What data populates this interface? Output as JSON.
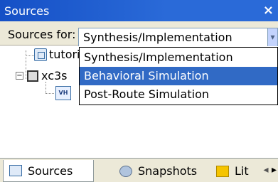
{
  "panel": {
    "title": "Sources"
  },
  "filter": {
    "label": "Sources for:",
    "selected": "Synthesis/Implementation",
    "options": [
      "Synthesis/Implementation",
      "Behavioral Simulation",
      "Post-Route Simulation"
    ],
    "highlighted_index": 1
  },
  "tree": {
    "items": [
      {
        "label": "tutori",
        "icon": "project-doc-icon"
      },
      {
        "label": "xc3s",
        "icon": "chip-icon",
        "expander": "−"
      },
      {
        "label": "",
        "icon": "vhdl-file-icon"
      }
    ]
  },
  "tabs": [
    {
      "label": "Sources",
      "icon": "sources-tab-icon",
      "active": true
    },
    {
      "label": "Snapshots",
      "icon": "snapshots-tab-icon",
      "active": false
    },
    {
      "label": "Lit",
      "icon": "libraries-tab-icon",
      "active": false
    }
  ],
  "colors": {
    "title_bar": "#2a6ad8",
    "selection": "#316ac5"
  }
}
